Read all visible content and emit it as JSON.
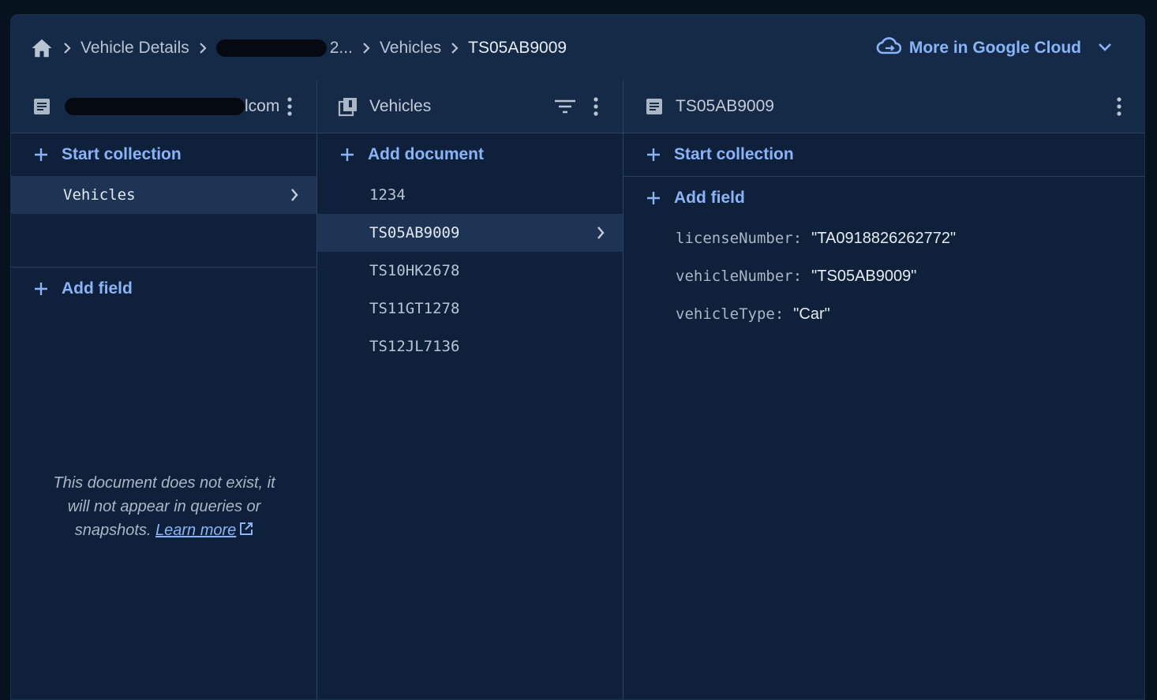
{
  "breadcrumb": {
    "items": [
      {
        "label": "Vehicle Details"
      },
      {
        "label": "2..."
      },
      {
        "label": "Vehicles"
      },
      {
        "label": "TS05AB9009"
      }
    ],
    "more_label": "More in Google Cloud"
  },
  "column1": {
    "title": "lcom",
    "start_collection_label": "Start collection",
    "collections": [
      {
        "label": "Vehicles"
      }
    ],
    "add_field_label": "Add field",
    "notice_text": "This document does not exist, it will not appear in queries or snapshots.",
    "learn_more_label": "Learn more"
  },
  "column2": {
    "title": "Vehicles",
    "add_document_label": "Add document",
    "documents": [
      {
        "label": "1234"
      },
      {
        "label": "TS05AB9009",
        "selected": true
      },
      {
        "label": "TS10HK2678"
      },
      {
        "label": "TS11GT1278"
      },
      {
        "label": "TS12JL7136"
      }
    ]
  },
  "column3": {
    "title": "TS05AB9009",
    "start_collection_label": "Start collection",
    "add_field_label": "Add field",
    "fields": [
      {
        "key": "licenseNumber",
        "value": "\"TA0918826262772\""
      },
      {
        "key": "vehicleNumber",
        "value": "\"TS05AB9009\""
      },
      {
        "key": "vehicleType",
        "value": "\"Car\""
      }
    ]
  },
  "colors": {
    "accent": "#8ab4f8",
    "panel": "#0f213a",
    "header": "#142a46",
    "selected_row": "#1d3454"
  }
}
